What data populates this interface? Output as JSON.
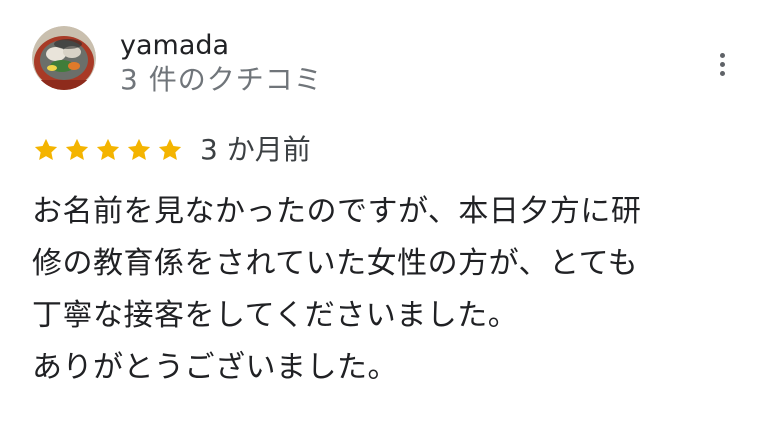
{
  "review": {
    "reviewer_name": "yamada",
    "review_count": "3 件のクチコミ",
    "rating": 5,
    "rating_max": 5,
    "time_ago": "3 か月前",
    "text_lines": [
      "お名前を見なかったのですが、本日夕方に研",
      "修の教育係をされていた女性の方が、とても",
      "丁寧な接客をしてくださいました。",
      "ありがとうございました。"
    ]
  },
  "icons": {
    "avatar": "food-photo-avatar",
    "more": "more-vertical-icon",
    "star": "star-icon"
  },
  "colors": {
    "star": "#f4b400",
    "name": "#202124",
    "secondary": "#70757a",
    "body_text": "#202124"
  }
}
